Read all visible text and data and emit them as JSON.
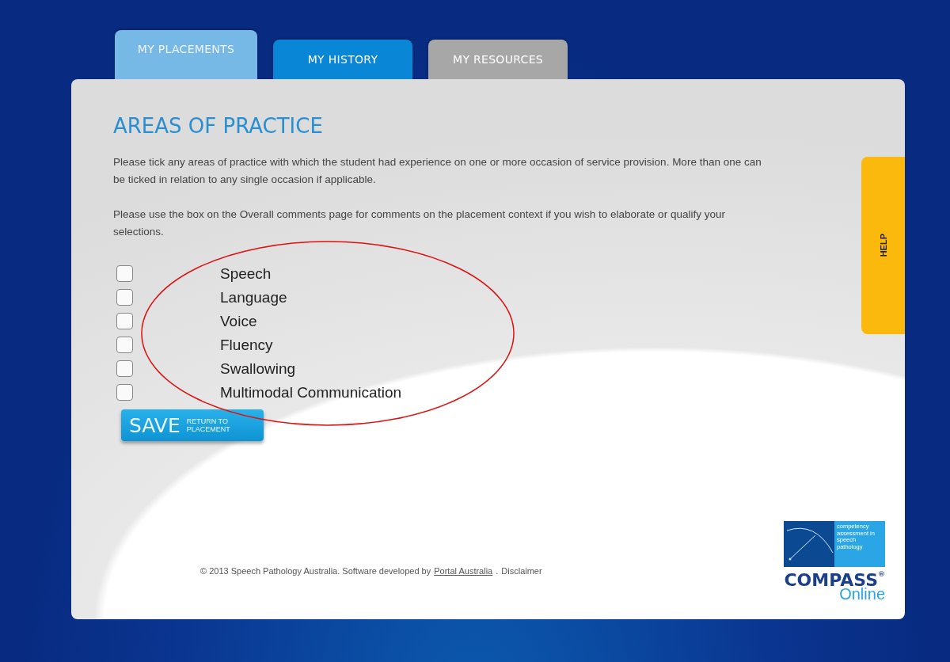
{
  "tabs": [
    {
      "label": "MY PLACEMENTS",
      "selected": true,
      "color": "#7cc0ec"
    },
    {
      "label": "MY HISTORY",
      "selected": false,
      "color": "#0a86d6"
    },
    {
      "label": "MY RESOURCES",
      "selected": false,
      "color": "#a7a7a7"
    }
  ],
  "heading": "AREAS OF PRACTICE",
  "paragraphs": [
    "Please tick any areas of practice with which the student had experience on one or more occasion of service provision. More than one can be ticked in relation to any single occasion if applicable.",
    "Please use the box on the Overall comments page for comments on the placement context if you wish to elaborate or qualify your selections."
  ],
  "areas": [
    {
      "label": "Speech",
      "checked": false
    },
    {
      "label": "Language",
      "checked": false
    },
    {
      "label": "Voice",
      "checked": false
    },
    {
      "label": "Fluency",
      "checked": false
    },
    {
      "label": "Swallowing",
      "checked": false
    },
    {
      "label": "Multimodal Communication",
      "checked": false
    }
  ],
  "save_button": {
    "label": "SAVE",
    "sublabel": "RETURN TO PLACEMENT"
  },
  "help_tab": "HELP",
  "footer": {
    "copyright": "© 2013 Speech Pathology Australia. Software developed by",
    "link": "Portal Australia",
    "separator": ".",
    "disclaimer": "Disclaimer"
  },
  "logo": {
    "tagline": "competency assessment in speech pathology",
    "name": "COMPASS",
    "mark": "®",
    "subtitle": "Online"
  }
}
